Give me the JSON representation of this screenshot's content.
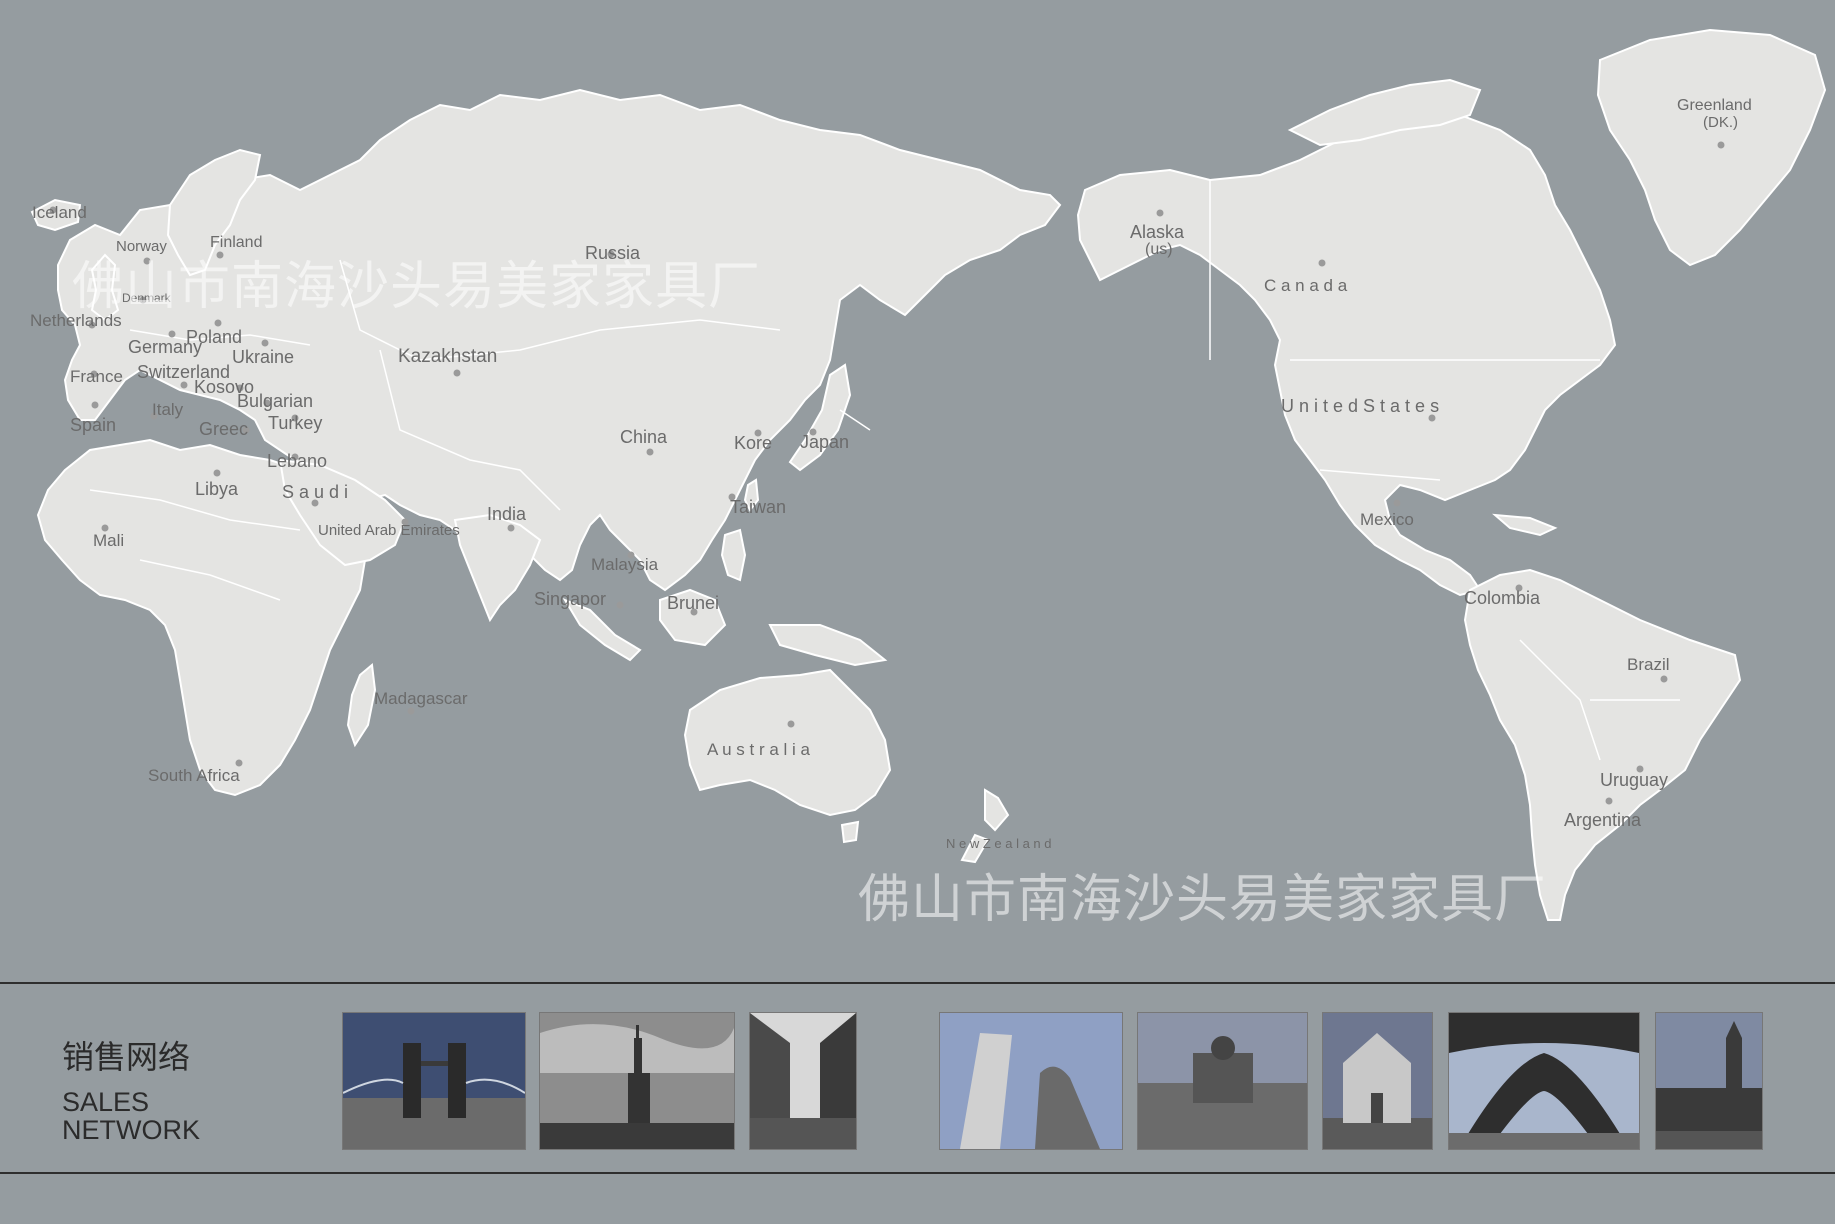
{
  "watermark": "佛山市南海沙头易美家家具厂",
  "labels": [
    {
      "id": "iceland",
      "text": "Iceland"
    },
    {
      "id": "norway",
      "text": "Norway"
    },
    {
      "id": "finland",
      "text": "Finland"
    },
    {
      "id": "russia",
      "text": "Russia"
    },
    {
      "id": "denmark",
      "text": "Denmark"
    },
    {
      "id": "netherlands",
      "text": "Netherlands"
    },
    {
      "id": "poland",
      "text": "Poland"
    },
    {
      "id": "germany",
      "text": "Germany"
    },
    {
      "id": "ukraine",
      "text": "Ukraine"
    },
    {
      "id": "kazakhstan",
      "text": "Kazakhstan"
    },
    {
      "id": "france",
      "text": "France"
    },
    {
      "id": "switzerland",
      "text": "Switzerland"
    },
    {
      "id": "kosovo",
      "text": "Kosovo"
    },
    {
      "id": "bulgarian",
      "text": "Bulgarian"
    },
    {
      "id": "italy",
      "text": "Italy"
    },
    {
      "id": "spain",
      "text": "Spain"
    },
    {
      "id": "turkey",
      "text": "Turkey"
    },
    {
      "id": "greece",
      "text": "Greec"
    },
    {
      "id": "lebano",
      "text": "Lebano"
    },
    {
      "id": "libya",
      "text": "Libya"
    },
    {
      "id": "saudi",
      "text": "S a u d i"
    },
    {
      "id": "uae",
      "text": "United Arab Emirates"
    },
    {
      "id": "mali",
      "text": "Mali"
    },
    {
      "id": "india",
      "text": "India"
    },
    {
      "id": "china",
      "text": "China"
    },
    {
      "id": "korea",
      "text": "Kore"
    },
    {
      "id": "japan",
      "text": "Japan"
    },
    {
      "id": "taiwan",
      "text": "Taiwan"
    },
    {
      "id": "malaysia",
      "text": "Malaysia"
    },
    {
      "id": "singapore",
      "text": "Singapor"
    },
    {
      "id": "brunei",
      "text": "Brunei"
    },
    {
      "id": "madagascar",
      "text": "Madagascar"
    },
    {
      "id": "south-africa",
      "text": "South Africa"
    },
    {
      "id": "australia",
      "text": "A u s t r a l i a"
    },
    {
      "id": "new-zealand",
      "text": "N e w  Z e a l a n d"
    },
    {
      "id": "alaska",
      "text": "Alaska"
    },
    {
      "id": "alaska-us",
      "text": "(us)"
    },
    {
      "id": "canada",
      "text": "C a n a d a"
    },
    {
      "id": "greenland",
      "text": "Greenland"
    },
    {
      "id": "greenland-dk",
      "text": "(DK.)"
    },
    {
      "id": "united-states",
      "text": "U n i t e d   S t a t e s"
    },
    {
      "id": "mexico",
      "text": "Mexico"
    },
    {
      "id": "colombia",
      "text": "Colombia"
    },
    {
      "id": "brazil",
      "text": "Brazil"
    },
    {
      "id": "uruguay",
      "text": "Uruguay"
    },
    {
      "id": "argentina",
      "text": "Argentina"
    }
  ],
  "footer": {
    "title_cn": "销售网络",
    "title_en_line1": "SALES",
    "title_en_line2": "NETWORK"
  },
  "photos": [
    {
      "icon": "tower-bridge-photo"
    },
    {
      "icon": "statue-of-liberty-photo"
    },
    {
      "icon": "regent-street-photo"
    },
    {
      "icon": "leaning-tower-pisa-photo"
    },
    {
      "icon": "classical-building-photo"
    },
    {
      "icon": "santa-croce-photo"
    },
    {
      "icon": "eiffel-tower-photo"
    },
    {
      "icon": "big-ben-photo"
    }
  ]
}
